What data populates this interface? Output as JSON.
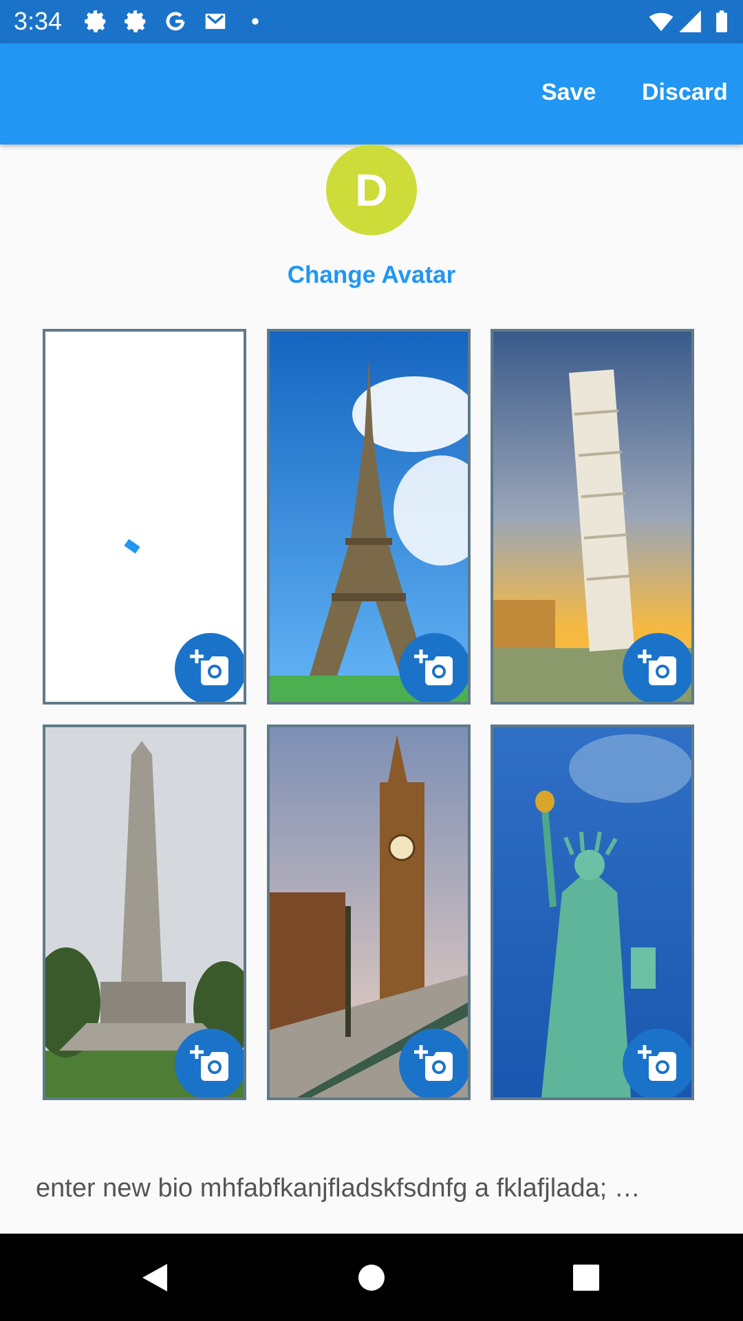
{
  "status_bar": {
    "time": "3:34",
    "icons": [
      "gear-icon",
      "gear-icon",
      "google-icon",
      "gmail-icon",
      "dot-icon",
      "wifi-icon",
      "signal-icon",
      "battery-icon"
    ]
  },
  "app_bar": {
    "save_label": "Save",
    "discard_label": "Discard",
    "color": "#2196f3"
  },
  "profile": {
    "avatar_letter": "D",
    "avatar_color": "#cddc39",
    "change_avatar_label": "Change Avatar"
  },
  "photos": [
    {
      "subject": "empty-loading",
      "action_icon": "add-photo-icon"
    },
    {
      "subject": "eiffel-tower",
      "action_icon": "add-photo-icon"
    },
    {
      "subject": "leaning-tower-of-pisa",
      "action_icon": "add-photo-icon"
    },
    {
      "subject": "obelisk-monument",
      "action_icon": "add-photo-icon"
    },
    {
      "subject": "big-ben",
      "action_icon": "add-photo-icon"
    },
    {
      "subject": "statue-of-liberty",
      "action_icon": "add-photo-icon"
    }
  ],
  "bio": {
    "value": "enter new bio mhfabfkanjfladskfsdnfg a fklafjlada; …"
  },
  "nav_bar": {
    "icons": [
      "back-icon",
      "home-icon",
      "recents-icon"
    ]
  }
}
